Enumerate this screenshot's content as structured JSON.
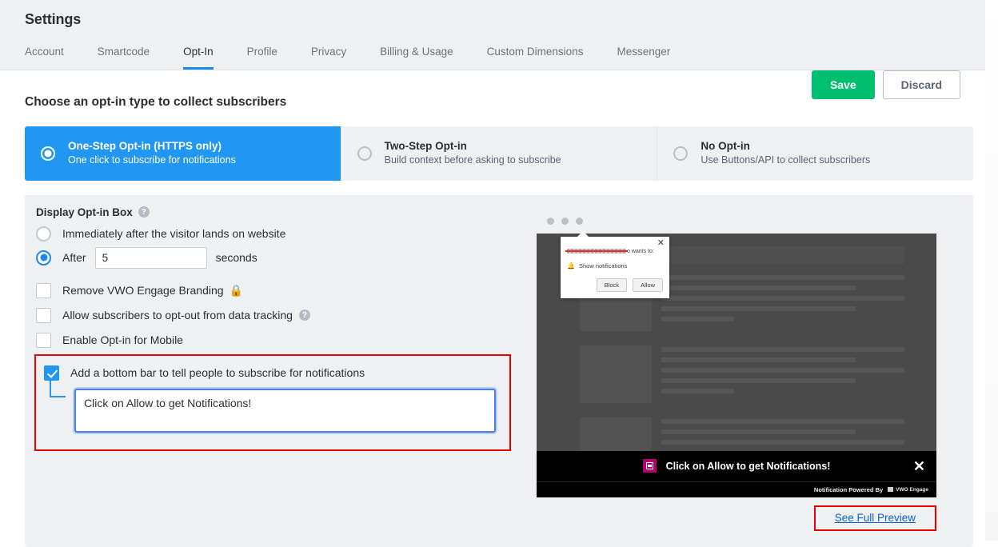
{
  "header": {
    "title": "Settings",
    "tabs": [
      {
        "label": "Account",
        "active": false
      },
      {
        "label": "Smartcode",
        "active": false
      },
      {
        "label": "Opt-In",
        "active": true
      },
      {
        "label": "Profile",
        "active": false
      },
      {
        "label": "Privacy",
        "active": false
      },
      {
        "label": "Billing & Usage",
        "active": false
      },
      {
        "label": "Custom Dimensions",
        "active": false
      },
      {
        "label": "Messenger",
        "active": false
      }
    ]
  },
  "toolbar": {
    "save_label": "Save",
    "discard_label": "Discard"
  },
  "main": {
    "section_title": "Choose an opt-in type to collect subscribers",
    "optin_types": [
      {
        "title": "One-Step Opt-in (HTTPS only)",
        "subtitle": "One click to subscribe for notifications",
        "selected": true
      },
      {
        "title": "Two-Step Opt-in",
        "subtitle": "Build context before asking to subscribe",
        "selected": false
      },
      {
        "title": "No Opt-in",
        "subtitle": "Use Buttons/API to collect subscribers",
        "selected": false
      }
    ],
    "display_box": {
      "label": "Display Opt-in Box",
      "help_glyph": "?",
      "option_immediate": "Immediately after the visitor lands on website",
      "option_after": "After",
      "seconds_value": "5",
      "seconds_suffix": "seconds",
      "immediate_selected": false,
      "after_selected": true
    },
    "checkboxes": [
      {
        "label": "Remove VWO Engage Branding",
        "checked": false,
        "lock": "🔒",
        "help": false
      },
      {
        "label": "Allow subscribers to opt-out from data tracking",
        "checked": false,
        "lock": "",
        "help": true
      },
      {
        "label": "Enable Opt-in for Mobile",
        "checked": false,
        "lock": "",
        "help": false
      }
    ],
    "bottom_bar": {
      "checkbox_label": "Add a bottom bar to tell people to subscribe for notifications",
      "checked": true,
      "message_value": "Click on Allow to get Notifications!"
    }
  },
  "preview": {
    "permission_popup": {
      "close_glyph": "✕",
      "origin_redacted": true,
      "wants_to_text": "o wants to:",
      "bell_glyph": "🔔",
      "permission_item": "Show notifications",
      "block_label": "Block",
      "allow_label": "Allow"
    },
    "optin_bar": {
      "message": "Click on Allow to get Notifications!",
      "close_glyph": "✕",
      "powered_by": "Notification Powered By",
      "brand": "VWO Engage"
    },
    "full_preview_link": "See Full Preview"
  },
  "colors": {
    "accent_blue": "#2196f3",
    "tab_underline": "#1e88e5",
    "save_green": "#00bf6f",
    "highlight_red": "#ee0000",
    "panel_gray": "#eef0f2",
    "preview_dark": "#4a4a4a",
    "bar_icon_magenta": "#b3006b",
    "link_blue": "#0b63ce"
  }
}
